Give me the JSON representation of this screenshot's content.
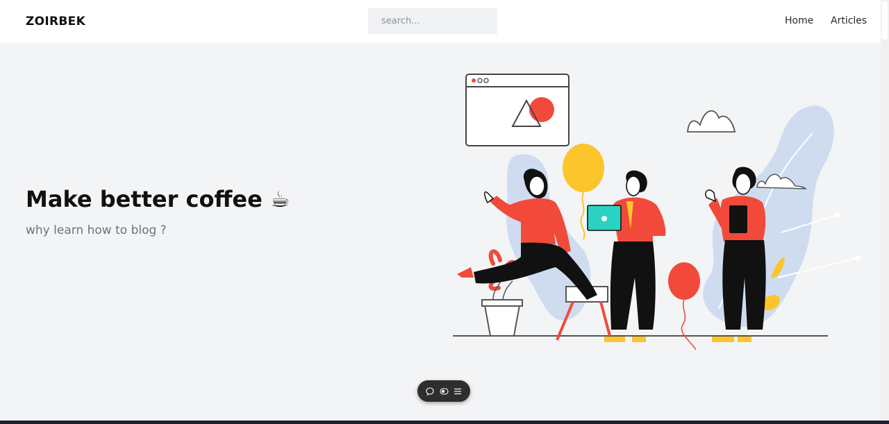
{
  "navbar": {
    "brand": "ZOIRBEK",
    "search_placeholder": "search...",
    "links": [
      {
        "label": "Home"
      },
      {
        "label": "Articles"
      }
    ]
  },
  "hero": {
    "title": "Make better coffee",
    "title_emoji": "☕",
    "subtitle": "why learn how to blog ?"
  },
  "toolbar": {
    "icons": [
      "comment-icon",
      "toggle-icon",
      "list-icon"
    ]
  },
  "colors": {
    "accent_red": "#f24a3a",
    "accent_yellow": "#fbc52b",
    "accent_teal": "#2ad3c1",
    "accent_blue_blob": "#cfdcf0",
    "background": "#f3f4f6"
  }
}
